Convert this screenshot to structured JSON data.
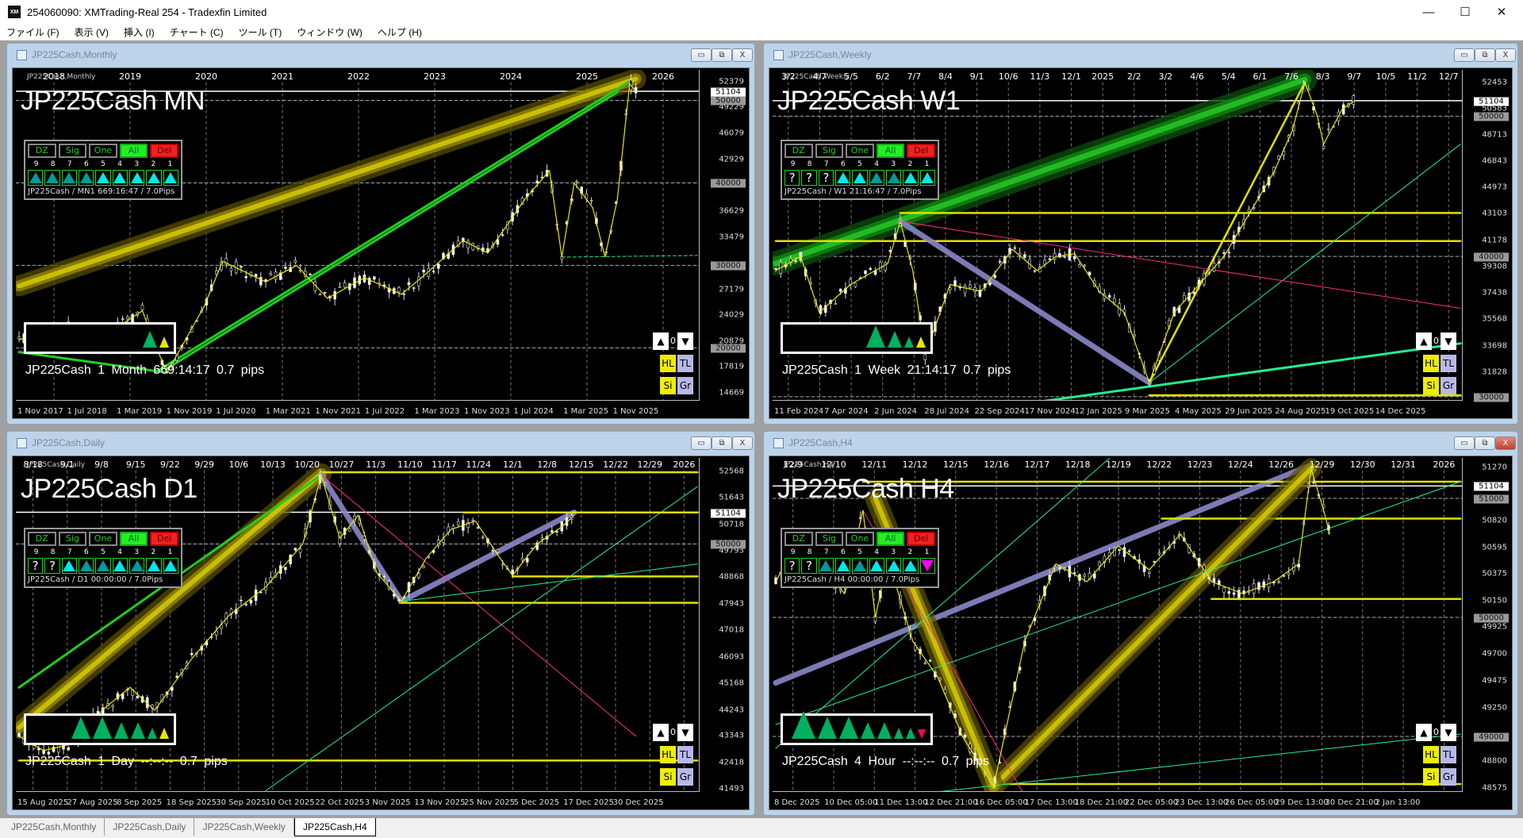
{
  "app": {
    "title": "254060090: XMTrading-Real 254 - Tradexfin Limited",
    "logo": "XM",
    "minimize": "—",
    "maximize": "☐",
    "close": "✕"
  },
  "menu": [
    "ファイル (F)",
    "表示 (V)",
    "挿入 (I)",
    "チャート (C)",
    "ツール (T)",
    "ウィンドウ (W)",
    "ヘルプ (H)"
  ],
  "colors": {
    "cyan": "#00e8e8",
    "teal": "#009a9a",
    "yellow": "#e8e800",
    "green": "#22cc22",
    "mint": "#20f090",
    "lavender": "#8a88c8",
    "magenta": "#ff2a8a"
  },
  "panel_buttons": [
    "DZ",
    "Sig",
    "One",
    "All",
    "Del"
  ],
  "panel_numbers": [
    "9",
    "8",
    "7",
    "6",
    "5",
    "4",
    "3",
    "2",
    "1"
  ],
  "side_buttons": {
    "up": "▲",
    "count": "0",
    "down": "▼",
    "hl": "HL",
    "tl": "TL",
    "si": "Si",
    "gr": "Gr"
  },
  "window_buttons": {
    "min": "▭",
    "restore": "⧉",
    "close": "X"
  },
  "tabs": [
    {
      "label": "JP225Cash,Monthly",
      "active": false
    },
    {
      "label": "JP225Cash,Daily",
      "active": false
    },
    {
      "label": "JP225Cash,Weekly",
      "active": false
    },
    {
      "label": "JP225Cash,H4",
      "active": true
    }
  ],
  "charts": [
    {
      "window_title": "JP225Cash,Monthly",
      "symbol_label": "JP225Cash,Monthly",
      "big_title": "JP225Cash MN",
      "panel_info": "JP225Cash / MN1 669:16:47 / 7.0Pips",
      "footer": "JP225Cash  1 Month  669:14:17  0.7 pips",
      "tri_states": [
        "dark",
        "dark",
        "dark",
        "dark",
        "up",
        "up",
        "up",
        "up",
        "up"
      ],
      "footer_tris": [
        "g2",
        "y1"
      ],
      "top_labels": [
        "2018",
        "2019",
        "2020",
        "2021",
        "2022",
        "2023",
        "2024",
        "2025",
        "2026"
      ],
      "bottom_labels": [
        "1 Nov 2017",
        "1 Jul 2018",
        "1 Mar 2019",
        "1 Nov 2019",
        "1 Jul 2020",
        "1 Mar 2021",
        "1 Nov 2021",
        "1 Jul 2022",
        "1 Mar 2023",
        "1 Nov 2023",
        "1 Jul 2024",
        "1 Mar 2025",
        "1 Nov 2025"
      ],
      "price_ticks": [
        "52379",
        "49229",
        "46079",
        "42929",
        "36629",
        "33479",
        "27179",
        "24029",
        "20879",
        "17819",
        "14669"
      ],
      "badges": [
        "50000",
        "40000",
        "30000",
        "20000"
      ],
      "current": "51104",
      "ylim": [
        13400,
        53700
      ],
      "path": [
        [
          0,
          21000
        ],
        [
          8,
          22500
        ],
        [
          14,
          21500
        ],
        [
          20,
          24500
        ],
        [
          22,
          20500
        ],
        [
          24,
          17000
        ],
        [
          30,
          25000
        ],
        [
          33,
          30500
        ],
        [
          40,
          28000
        ],
        [
          45,
          30000
        ],
        [
          50,
          26000
        ],
        [
          56,
          28500
        ],
        [
          62,
          26500
        ],
        [
          66,
          29000
        ],
        [
          72,
          33000
        ],
        [
          76,
          31500
        ],
        [
          82,
          38000
        ],
        [
          86,
          41500
        ],
        [
          88,
          31000
        ],
        [
          90,
          40000
        ],
        [
          93,
          37000
        ],
        [
          95,
          31000
        ],
        [
          97,
          38000
        ],
        [
          99,
          52000
        ],
        [
          100,
          51104
        ]
      ],
      "lines": [
        [
          0,
          27500,
          100,
          52600,
          "glow-yellow"
        ],
        [
          22,
          17000,
          99,
          52300,
          "green"
        ],
        [
          24,
          17500,
          97,
          51000,
          "green"
        ],
        [
          0,
          19500,
          24,
          17000,
          "green"
        ],
        [
          88,
          31000,
          110,
          31200,
          "mint-dash"
        ]
      ]
    },
    {
      "window_title": "JP225Cash,Weekly",
      "symbol_label": "JP225Cash,Weekly",
      "big_title": "JP225Cash W1",
      "panel_info": "JP225Cash / W1 21:16:47 / 7.0Pips",
      "footer": "JP225Cash  1 Week  21:14:17  0.7 pips",
      "tri_states": [
        "q",
        "q",
        "q",
        "up",
        "up",
        "dark",
        "dark",
        "up",
        "up"
      ],
      "footer_tris": [
        "g3",
        "g2",
        "g1",
        "y1"
      ],
      "top_labels": [
        "3/2",
        "4/7",
        "5/5",
        "6/2",
        "7/7",
        "8/4",
        "9/1",
        "10/6",
        "11/3",
        "12/1",
        "2025",
        "2/2",
        "3/2",
        "4/6",
        "5/4",
        "6/1",
        "7/6",
        "8/3",
        "9/7",
        "10/5",
        "11/2",
        "12/7"
      ],
      "bottom_labels": [
        "11 Feb 2024",
        "7 Apr 2024",
        "2 Jun 2024",
        "28 Jul 2024",
        "22 Sep 2024",
        "17 Nov 2024",
        "12 Jan 2025",
        "9 Mar 2025",
        "4 May 2025",
        "29 Jun 2025",
        "24 Aug 2025",
        "19 Oct 2025",
        "14 Dec 2025"
      ],
      "price_ticks": [
        "52453",
        "50583",
        "48713",
        "46843",
        "44973",
        "43103",
        "41178",
        "39308",
        "37438",
        "35568",
        "33698",
        "31828"
      ],
      "badges": [
        "50000",
        "40000",
        "30000"
      ],
      "current": "51104",
      "ylim": [
        29600,
        53300
      ],
      "path": [
        [
          0,
          39000
        ],
        [
          4,
          40000
        ],
        [
          7,
          36000
        ],
        [
          12,
          38000
        ],
        [
          18,
          39500
        ],
        [
          20,
          42500
        ],
        [
          22,
          39000
        ],
        [
          24,
          33000
        ],
        [
          28,
          38000
        ],
        [
          33,
          37500
        ],
        [
          38,
          40500
        ],
        [
          42,
          39000
        ],
        [
          45,
          40000
        ],
        [
          48,
          40200
        ],
        [
          52,
          37500
        ],
        [
          56,
          36000
        ],
        [
          60,
          31000
        ],
        [
          64,
          36000
        ],
        [
          68,
          38000
        ],
        [
          72,
          40000
        ],
        [
          76,
          43000
        ],
        [
          80,
          46000
        ],
        [
          83,
          49000
        ],
        [
          85,
          52400
        ],
        [
          87,
          50000
        ],
        [
          88,
          48000
        ],
        [
          91,
          50500
        ],
        [
          93,
          51104
        ]
      ],
      "lines": [
        [
          0,
          39500,
          85,
          52600,
          "glow-green"
        ],
        [
          20,
          43100,
          110,
          43100,
          "yellow"
        ],
        [
          0,
          41100,
          110,
          41100,
          "yellow"
        ],
        [
          20,
          42500,
          60,
          31000,
          "lavender"
        ],
        [
          60,
          31000,
          85,
          52400,
          "yellow"
        ],
        [
          60,
          31000,
          110,
          48000,
          "mint"
        ],
        [
          20,
          42500,
          110,
          36300,
          "magenta"
        ],
        [
          40,
          29500,
          110,
          33800,
          "mint-thick"
        ],
        [
          60,
          30100,
          110,
          30100,
          "yellow"
        ]
      ]
    },
    {
      "window_title": "JP225Cash,Daily",
      "symbol_label": "JP225Cash,Daily",
      "big_title": "JP225Cash D1",
      "panel_info": "JP225Cash / D1 00:00:00 / 7.0Pips",
      "footer": "JP225Cash  1 Day  --:--:--  0.7 pips",
      "tri_states": [
        "q",
        "q",
        "up",
        "dark",
        "dark",
        "up",
        "dark",
        "up",
        "up"
      ],
      "footer_tris": [
        "g3",
        "g3",
        "g2",
        "g2",
        "g1",
        "y1"
      ],
      "top_labels": [
        "8/18",
        "9/1",
        "9/8",
        "9/15",
        "9/22",
        "9/29",
        "10/6",
        "10/13",
        "10/20",
        "10/27",
        "11/3",
        "11/10",
        "11/17",
        "11/24",
        "12/1",
        "12/8",
        "12/15",
        "12/22",
        "12/29",
        "2026"
      ],
      "bottom_labels": [
        "15 Aug 2025",
        "27 Aug 2025",
        "8 Sep 2025",
        "18 Sep 2025",
        "30 Sep 2025",
        "10 Oct 2025",
        "22 Oct 2025",
        "3 Nov 2025",
        "13 Nov 2025",
        "25 Nov 2025",
        "5 Dec 2025",
        "17 Dec 2025",
        "30 Dec 2025"
      ],
      "price_ticks": [
        "52568",
        "51643",
        "50718",
        "49793",
        "48868",
        "47943",
        "47018",
        "46093",
        "45168",
        "44243",
        "43343",
        "42418",
        "41493"
      ],
      "badges": [
        "50000"
      ],
      "current": "51104",
      "ylim": [
        41300,
        53000
      ],
      "path": [
        [
          0,
          43300
        ],
        [
          4,
          42800
        ],
        [
          8,
          43000
        ],
        [
          14,
          44300
        ],
        [
          18,
          45000
        ],
        [
          22,
          44200
        ],
        [
          28,
          46000
        ],
        [
          34,
          47500
        ],
        [
          40,
          48500
        ],
        [
          46,
          50000
        ],
        [
          49,
          52400
        ],
        [
          52,
          50200
        ],
        [
          55,
          51000
        ],
        [
          58,
          49000
        ],
        [
          62,
          48000
        ],
        [
          66,
          49500
        ],
        [
          70,
          50500
        ],
        [
          74,
          50800
        ],
        [
          78,
          49500
        ],
        [
          80,
          48900
        ],
        [
          84,
          50000
        ],
        [
          88,
          50600
        ],
        [
          90,
          51000
        ]
      ],
      "lines": [
        [
          0,
          43600,
          49,
          52450,
          "glow-yellow"
        ],
        [
          49,
          52500,
          110,
          52500,
          "yellow"
        ],
        [
          0,
          45000,
          49,
          52400,
          "green"
        ],
        [
          49,
          52400,
          62,
          48000,
          "lavender"
        ],
        [
          62,
          48000,
          90,
          51100,
          "lavender"
        ],
        [
          49,
          52400,
          100,
          43300,
          "magenta"
        ],
        [
          62,
          47950,
          110,
          47950,
          "yellow"
        ],
        [
          80,
          48870,
          110,
          48870,
          "yellow"
        ],
        [
          0,
          42450,
          110,
          42450,
          "yellow"
        ],
        [
          62,
          48000,
          110,
          49300,
          "mint"
        ],
        [
          40,
          41400,
          110,
          52000,
          "mint"
        ],
        [
          72,
          51100,
          110,
          51100,
          "yellow"
        ]
      ]
    },
    {
      "window_title": "JP225Cash,H4",
      "symbol_label": "JP225Cash,H4",
      "big_title": "JP225Cash H4",
      "panel_info": "JP225Cash / H4 00:00:00 / 7.0Pips",
      "footer": "JP225Cash  4 Hour  --:--:--  0.7 pips",
      "tri_states": [
        "q",
        "q",
        "dark",
        "up",
        "dark",
        "up",
        "up",
        "up",
        "down"
      ],
      "footer_tris": [
        "g4",
        "g3",
        "g3",
        "g2",
        "g2",
        "g1",
        "g1",
        "m1"
      ],
      "top_labels": [
        "12/9",
        "12/10",
        "12/11",
        "12/12",
        "12/15",
        "12/16",
        "12/17",
        "12/18",
        "12/19",
        "12/22",
        "12/23",
        "12/24",
        "12/26",
        "12/29",
        "12/30",
        "12/31",
        "2026"
      ],
      "bottom_labels": [
        "8 Dec 2025",
        "10 Dec 05:00",
        "11 Dec 13:00",
        "12 Dec 21:00",
        "16 Dec 05:00",
        "17 Dec 13:00",
        "18 Dec 21:00",
        "22 Dec 05:00",
        "23 Dec 13:00",
        "26 Dec 05:00",
        "29 Dec 13:00",
        "30 Dec 21:00",
        "2 Jan 13:00"
      ],
      "price_ticks": [
        "51270",
        "50820",
        "50595",
        "50375",
        "50150",
        "49925",
        "49700",
        "49475",
        "49250",
        "48800",
        "48575"
      ],
      "badges": [
        "51000",
        "50000",
        "49000"
      ],
      "current": "51104",
      "ylim": [
        48520,
        51340
      ],
      "path": [
        [
          0,
          50300
        ],
        [
          4,
          50700
        ],
        [
          8,
          50400
        ],
        [
          11,
          50200
        ],
        [
          14,
          50900
        ],
        [
          16,
          50000
        ],
        [
          18,
          50500
        ],
        [
          22,
          49800
        ],
        [
          26,
          49500
        ],
        [
          30,
          49000
        ],
        [
          35,
          48580
        ],
        [
          40,
          49800
        ],
        [
          45,
          50450
        ],
        [
          50,
          50300
        ],
        [
          55,
          50600
        ],
        [
          60,
          50400
        ],
        [
          65,
          50700
        ],
        [
          70,
          50300
        ],
        [
          75,
          50200
        ],
        [
          80,
          50300
        ],
        [
          84,
          50450
        ],
        [
          86,
          51250
        ],
        [
          88,
          50900
        ],
        [
          89,
          50700
        ]
      ],
      "lines": [
        [
          0,
          49450,
          86,
          51280
        ],
        [
          0,
          49450,
          86,
          51280,
          "lavender"
        ],
        [
          14,
          51140,
          110,
          51140,
          "yellow"
        ],
        [
          62,
          50830,
          110,
          50830,
          "yellow"
        ],
        [
          70,
          50155,
          110,
          50155,
          "yellow"
        ],
        [
          35,
          48600,
          110,
          48600,
          "yellow"
        ],
        [
          35,
          48580,
          86,
          51250,
          "glow-yellow"
        ],
        [
          16,
          51000,
          35,
          48580,
          "glow-yellow"
        ],
        [
          0,
          49100,
          110,
          51140,
          "mint"
        ],
        [
          0,
          48900,
          55,
          51400,
          "mint"
        ],
        [
          20,
          48500,
          110,
          49020,
          "mint"
        ],
        [
          14,
          50900,
          40,
          48500,
          "magenta"
        ]
      ]
    }
  ]
}
